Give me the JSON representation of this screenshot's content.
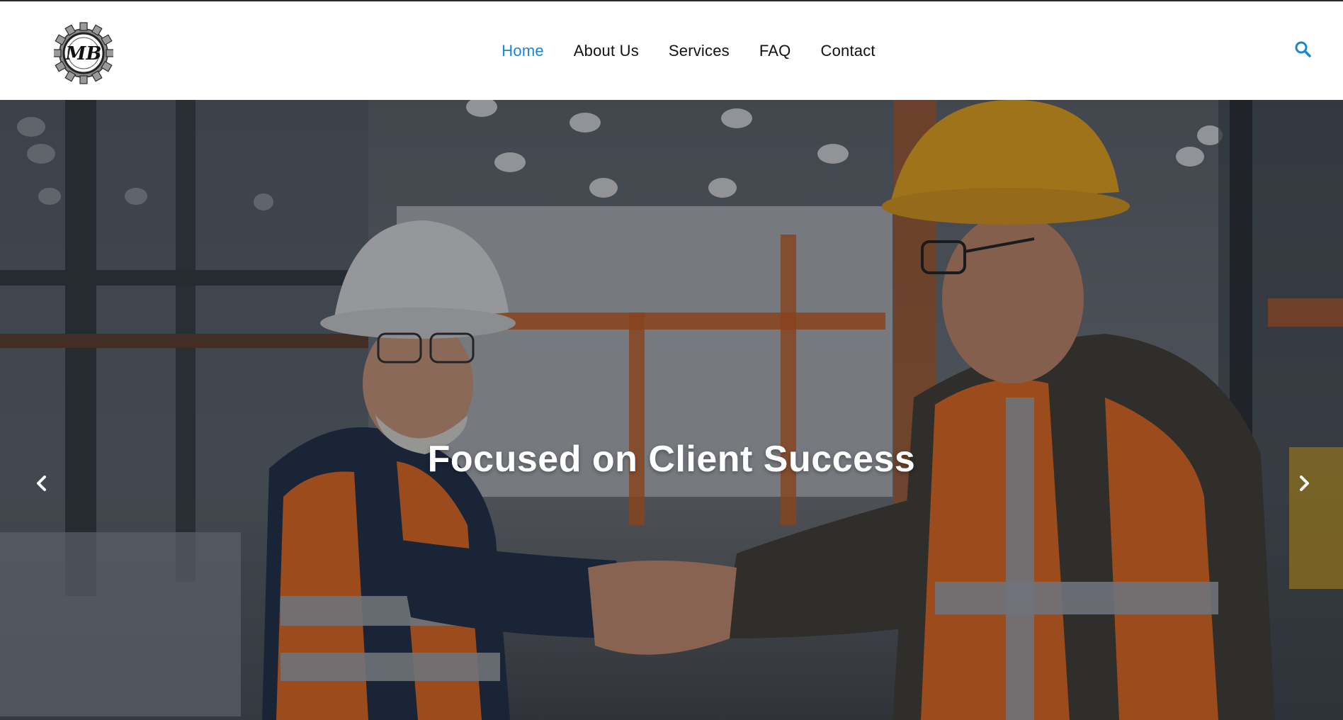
{
  "header": {
    "logo_text": "MB",
    "nav": [
      {
        "label": "Home",
        "active": true
      },
      {
        "label": "About Us",
        "active": false
      },
      {
        "label": "Services",
        "active": false
      },
      {
        "label": "FAQ",
        "active": false
      },
      {
        "label": "Contact",
        "active": false
      }
    ],
    "search_icon": "search-icon"
  },
  "hero": {
    "title": "Focused on Client Success",
    "prev_icon": "chevron-left-icon",
    "next_icon": "chevron-right-icon"
  },
  "colors": {
    "accent": "#1a86d0",
    "nav_text": "#111111",
    "hero_text": "#ffffff"
  }
}
